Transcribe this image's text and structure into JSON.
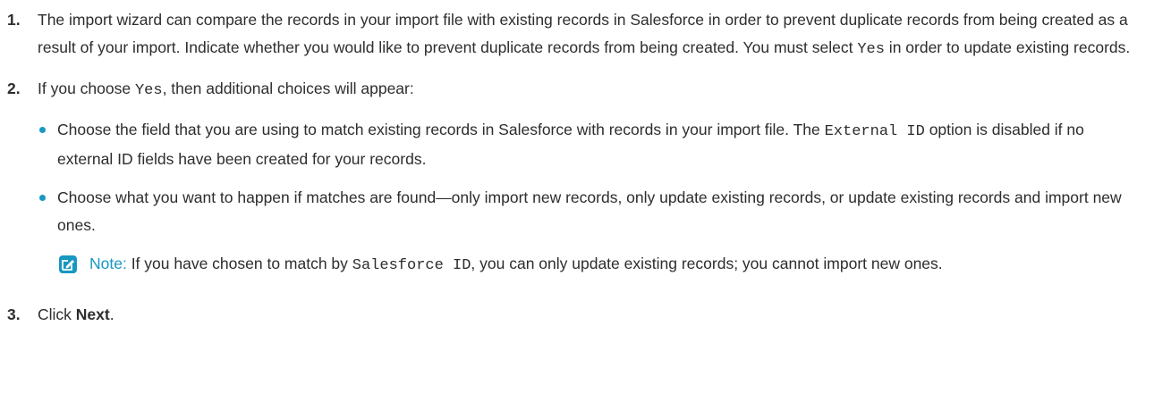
{
  "steps": [
    {
      "number": "1.",
      "text_a": "The import wizard can compare the records in your import file with existing records in Salesforce in order to prevent duplicate records from being created as a result of your import. Indicate whether you would like to prevent duplicate records from being created. You must select ",
      "code": "Yes",
      "text_b": " in order to update existing records."
    },
    {
      "number": "2.",
      "text_a": "If you choose ",
      "code": "Yes",
      "text_b": ", then additional choices will appear:",
      "bullets": [
        {
          "text_a": "Choose the field that you are using to match existing records in Salesforce with records in your import file. The ",
          "code": "External ID",
          "text_b": " option is disabled if no external ID fields have been created for your records."
        },
        {
          "text": "Choose what you want to happen if matches are found—only import new records, only update existing records, or update existing records and import new ones."
        }
      ],
      "note": {
        "label": "Note:",
        "text_a": " If you have chosen to match by ",
        "code": "Salesforce ID",
        "text_b": ", you can only update existing records; you cannot import new ones.",
        "icon": "edit-note-icon",
        "icon_color": "#1798c1"
      }
    },
    {
      "number": "3.",
      "text_a": "Click ",
      "bold": "Next",
      "text_b": "."
    }
  ],
  "colors": {
    "accent": "#1798c1",
    "text": "#2d2d2d"
  }
}
